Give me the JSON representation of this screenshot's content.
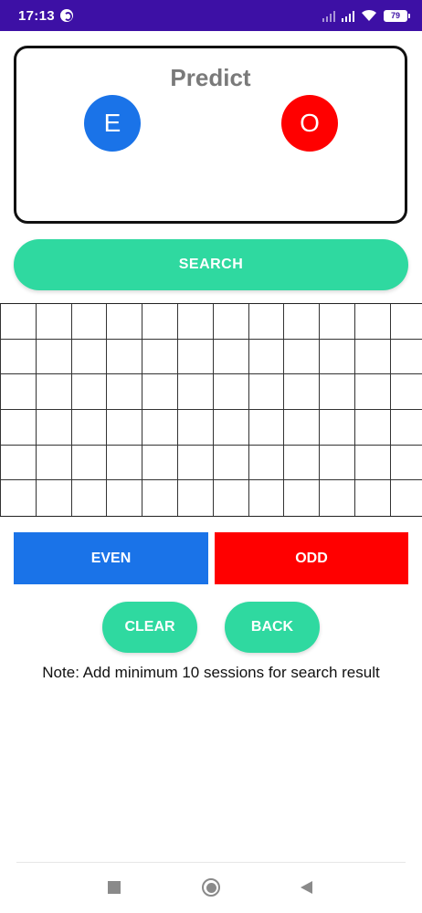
{
  "status_bar": {
    "time": "17:13",
    "battery_level": "79",
    "icons": [
      "app-notification-icon",
      "signal-weak-icon",
      "signal-icon",
      "wifi-icon",
      "battery-icon"
    ]
  },
  "predict": {
    "title": "Predict",
    "even_label": "E",
    "odd_label": "O"
  },
  "search_label": "SEARCH",
  "grid": {
    "rows": 6,
    "columns": 12
  },
  "buttons": {
    "even": "EVEN",
    "odd": "ODD",
    "clear": "CLEAR",
    "back": "BACK"
  },
  "note": "Note: Add minimum 10 sessions for search result",
  "colors": {
    "status_bar": "#3d10a5",
    "accent_green": "#2fd9a0",
    "even_blue": "#1a73e8",
    "odd_red": "#ff0000",
    "title_gray": "#7a7a7a"
  },
  "nav_bar": {
    "icons": [
      "recents-icon",
      "home-icon",
      "back-icon"
    ]
  }
}
